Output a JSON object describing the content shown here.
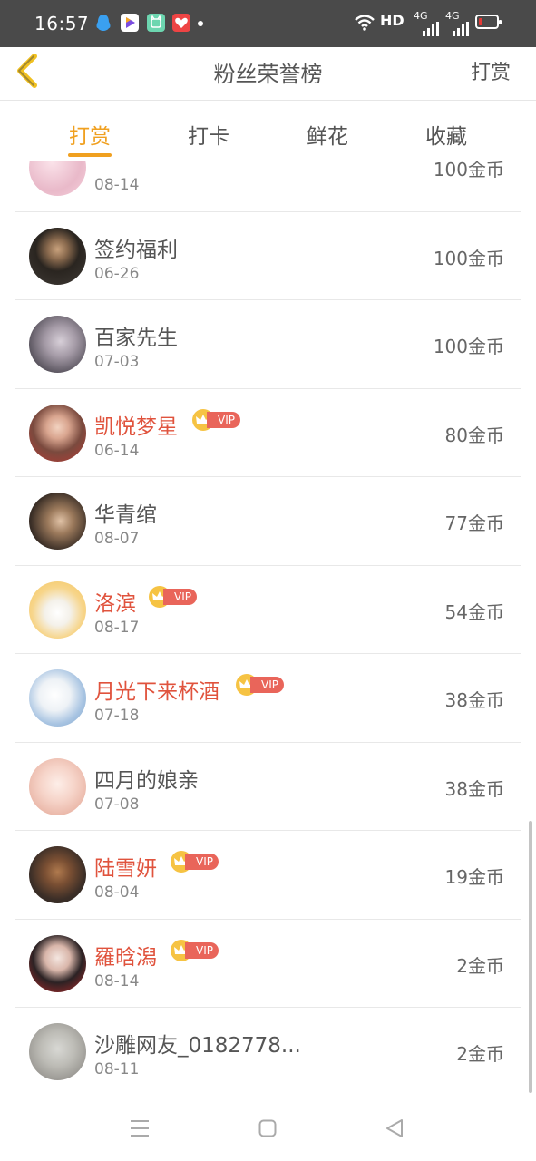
{
  "status_bar": {
    "time": "16:57",
    "network_label": "HD",
    "signal_1": "4G",
    "signal_2": "4G"
  },
  "header": {
    "title": "粉丝荣誉榜",
    "action_label": "打赏"
  },
  "tabs": [
    {
      "label": "打赏",
      "active": true
    },
    {
      "label": "打卡",
      "active": false
    },
    {
      "label": "鲜花",
      "active": false
    },
    {
      "label": "收藏",
      "active": false
    }
  ],
  "vip_label": "VIP",
  "fans": [
    {
      "name": "",
      "date": "08-14",
      "amount": "100金币",
      "vip": false
    },
    {
      "name": "签约福利",
      "date": "06-26",
      "amount": "100金币",
      "vip": false
    },
    {
      "name": "百家先生",
      "date": "07-03",
      "amount": "100金币",
      "vip": false
    },
    {
      "name": "凯悦梦星",
      "date": "06-14",
      "amount": "80金币",
      "vip": true
    },
    {
      "name": "华青绾",
      "date": "08-07",
      "amount": "77金币",
      "vip": false
    },
    {
      "name": "洛滨",
      "date": "08-17",
      "amount": "54金币",
      "vip": true
    },
    {
      "name": "月光下来杯酒",
      "date": "07-18",
      "amount": "38金币",
      "vip": true
    },
    {
      "name": "四月的娘亲",
      "date": "07-08",
      "amount": "38金币",
      "vip": false
    },
    {
      "name": "陆雪妍",
      "date": "08-04",
      "amount": "19金币",
      "vip": true
    },
    {
      "name": "羅晗潟",
      "date": "08-14",
      "amount": "2金币",
      "vip": true
    },
    {
      "name": "沙雕网友_0182778...",
      "date": "08-11",
      "amount": "2金币",
      "vip": false
    }
  ],
  "colors": {
    "accent": "#f0a020",
    "vip_name": "#e0533d",
    "vip_tag": "#e9655a",
    "status_bar_bg": "#4a4a4a"
  },
  "icons": {
    "back": "chevron-left-icon",
    "nav_menu": "menu-icon",
    "nav_home": "home-square-icon",
    "nav_back": "back-triangle-icon"
  }
}
